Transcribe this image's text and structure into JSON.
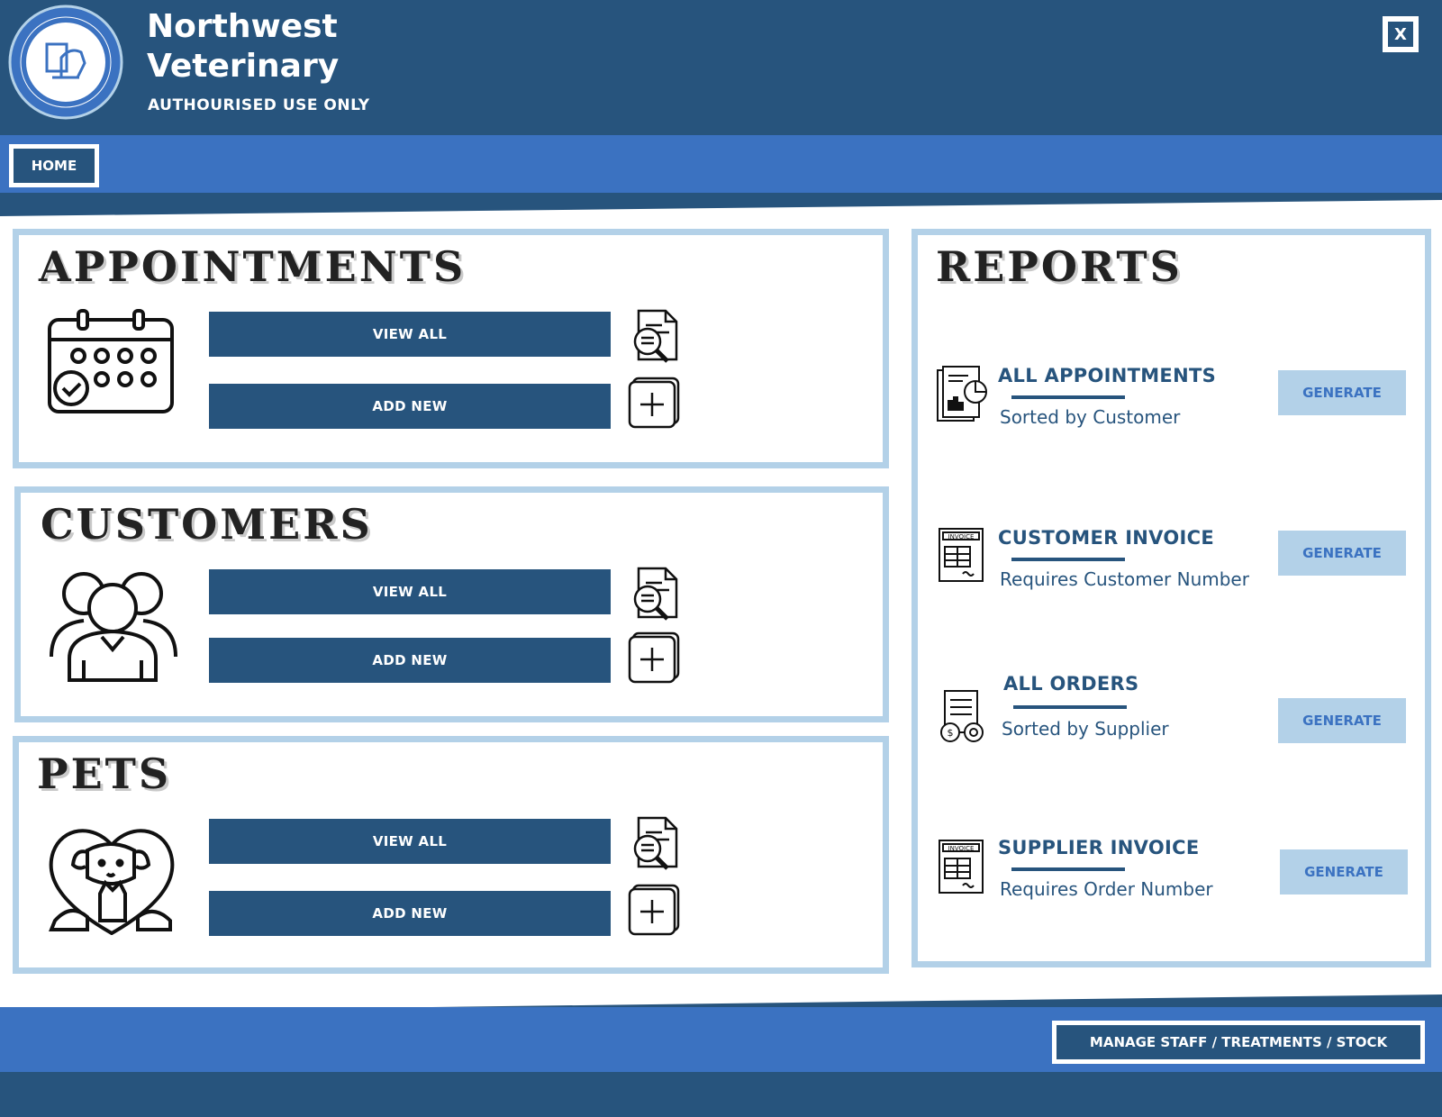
{
  "header": {
    "brand_line1": "Northwest",
    "brand_line2": "Veterinary",
    "tagline": "AUTHOURISED USE ONLY",
    "close_label": "X"
  },
  "nav": {
    "home_label": "HOME"
  },
  "sections": {
    "appointments": {
      "title": "APPOINTMENTS",
      "view_all": "VIEW ALL",
      "add_new": "ADD NEW"
    },
    "customers": {
      "title": "CUSTOMERS",
      "view_all": "VIEW ALL",
      "add_new": "ADD NEW"
    },
    "pets": {
      "title": "PETS",
      "view_all": "VIEW ALL",
      "add_new": "ADD NEW"
    }
  },
  "reports": {
    "title": "REPORTS",
    "items": [
      {
        "title": "ALL APPOINTMENTS",
        "subtitle": "Sorted by Customer",
        "button": "GENERATE"
      },
      {
        "title": "CUSTOMER INVOICE",
        "subtitle": "Requires Customer Number",
        "button": "GENERATE"
      },
      {
        "title": "ALL ORDERS",
        "subtitle": "Sorted by Supplier",
        "button": "GENERATE"
      },
      {
        "title": "SUPPLIER INVOICE",
        "subtitle": "Requires Order Number",
        "button": "GENERATE"
      }
    ]
  },
  "footer": {
    "manage_label": "MANAGE STAFF / TREATMENTS / STOCK"
  },
  "colors": {
    "dark_blue": "#27547d",
    "mid_blue": "#3b72c1",
    "light_blue": "#b3d1e8"
  }
}
